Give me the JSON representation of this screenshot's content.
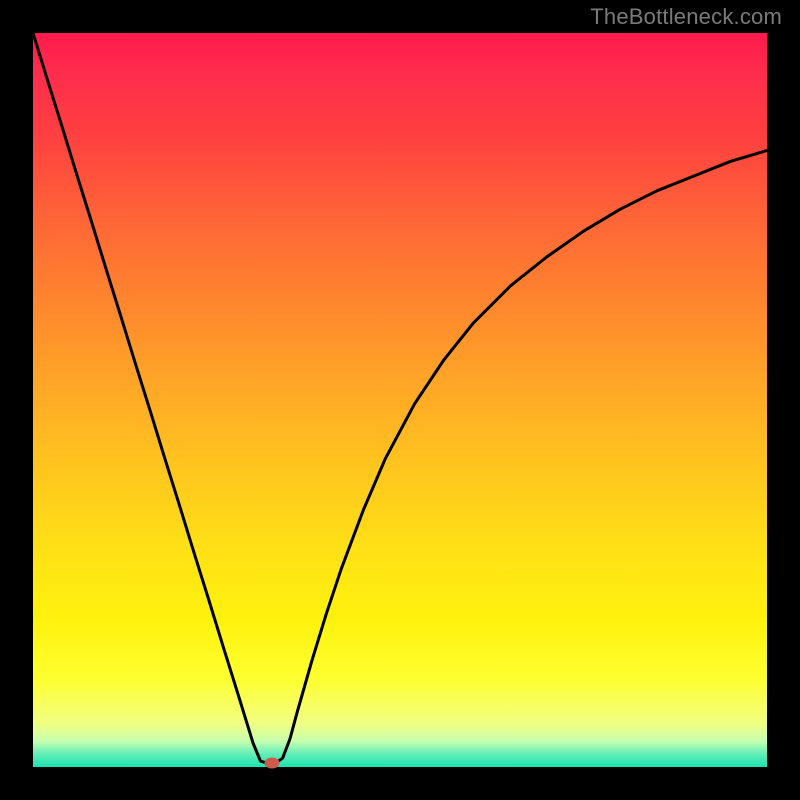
{
  "watermark": "TheBottleneck.com",
  "chart_data": {
    "type": "line",
    "title": "",
    "xlabel": "",
    "ylabel": "",
    "xlim": [
      0,
      100
    ],
    "ylim": [
      0,
      100
    ],
    "grid": false,
    "legend": false,
    "series": [
      {
        "name": "curve",
        "x": [
          0,
          2,
          4,
          6,
          8,
          10,
          12,
          14,
          16,
          18,
          20,
          22,
          24,
          26,
          28,
          30,
          31,
          32,
          33,
          34,
          35,
          36,
          38,
          40,
          42,
          45,
          48,
          52,
          56,
          60,
          65,
          70,
          75,
          80,
          85,
          90,
          95,
          100
        ],
        "values": [
          100,
          93.5,
          87.1,
          80.6,
          74.2,
          67.7,
          61.3,
          54.8,
          48.4,
          41.9,
          35.5,
          29.0,
          22.6,
          16.1,
          9.7,
          3.2,
          0.8,
          0.5,
          0.5,
          1.2,
          3.8,
          7.5,
          14.5,
          21.0,
          27.0,
          35.0,
          42.0,
          49.5,
          55.5,
          60.5,
          65.5,
          69.5,
          73.0,
          76.0,
          78.5,
          80.5,
          82.5,
          84.0
        ]
      }
    ],
    "marker": {
      "x": 32.5,
      "y": 0.5
    },
    "gradient_stops": [
      {
        "pos": 0,
        "color": "#ff1a4c"
      },
      {
        "pos": 50,
        "color": "#ffb020"
      },
      {
        "pos": 85,
        "color": "#fff20d"
      },
      {
        "pos": 100,
        "color": "#19e3b2"
      }
    ]
  }
}
